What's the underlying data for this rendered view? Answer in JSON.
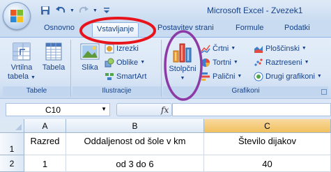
{
  "window": {
    "title": "Microsoft Excel - Zvezek1"
  },
  "quick_access": {
    "icons": [
      "save-icon",
      "undo-icon",
      "redo-icon",
      "customize-icon"
    ]
  },
  "tabs": [
    {
      "label": "Osnovno",
      "active": false
    },
    {
      "label": "Vstavljanje",
      "active": true
    },
    {
      "label": "Postavitev strani",
      "active": false
    },
    {
      "label": "Formule",
      "active": false
    },
    {
      "label": "Podatki",
      "active": false
    }
  ],
  "ribbon": {
    "groups": {
      "tabele": {
        "label": "Tabele",
        "pivot_label_line1": "Vrtilna",
        "pivot_label_line2": "tabela",
        "table_label": "Tabela"
      },
      "ilustracije": {
        "label": "Ilustracije",
        "picture_label": "Slika",
        "clipart_label": "Izrezki",
        "shapes_label": "Oblike",
        "smartart_label": "SmartArt"
      },
      "grafikoni": {
        "label": "Grafikoni",
        "column_label": "Stolpčni",
        "line_label": "Črtni",
        "pie_label": "Tortni",
        "bar_label": "Palični",
        "area_label": "Ploščinski",
        "scatter_label": "Raztreseni",
        "other_label": "Drugi grafikoni"
      }
    }
  },
  "formula_bar": {
    "name_box": "C10",
    "fx_label": "fx",
    "formula": ""
  },
  "sheet": {
    "columns": [
      "A",
      "B",
      "C"
    ],
    "selected_column": "C",
    "rows": [
      {
        "num": "1",
        "cells": [
          "Razred",
          "Oddaljenost od šole v km",
          "Število dijakov"
        ]
      },
      {
        "num": "2",
        "cells": [
          "1",
          "od 3 do 6",
          "40"
        ]
      }
    ]
  },
  "colors": {
    "annotation_red": "#e8141c",
    "annotation_purple": "#8c3aa6"
  }
}
